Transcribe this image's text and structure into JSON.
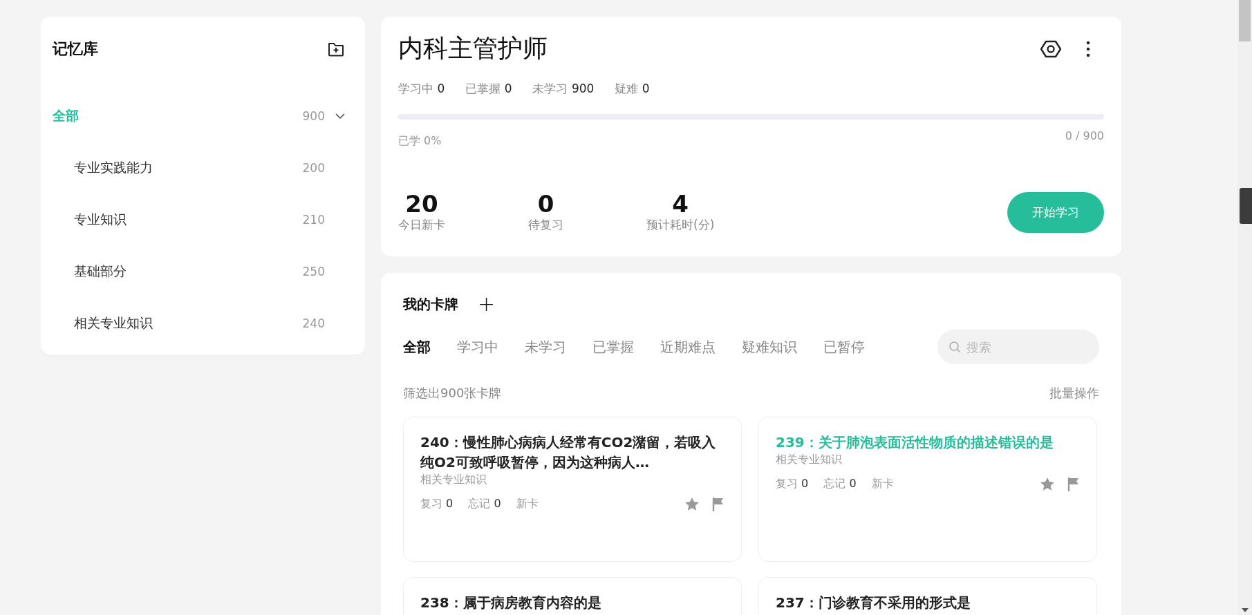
{
  "library": {
    "title": "记忆库",
    "items": [
      {
        "label": "全部",
        "count": "900",
        "selected": true,
        "expanded": true,
        "children": [
          {
            "label": "专业实践能力",
            "count": "200",
            "selected": false
          },
          {
            "label": "专业知识",
            "count": "210",
            "selected": false
          },
          {
            "label": "基础部分",
            "count": "250",
            "selected": false
          },
          {
            "label": "相关专业知识",
            "count": "240",
            "selected": false
          }
        ]
      }
    ]
  },
  "deck": {
    "title": "内科主管护师",
    "stats": [
      {
        "label": "学习中",
        "value": "0"
      },
      {
        "label": "已掌握",
        "value": "0"
      },
      {
        "label": "未学习",
        "value": "900"
      },
      {
        "label": "疑难",
        "value": "0"
      }
    ],
    "progress": {
      "level": 0,
      "label": "已学 0%",
      "count": "0 / 900"
    },
    "summary": [
      {
        "value": "20",
        "label": "今日新卡"
      },
      {
        "value": "0",
        "label": "待复习"
      },
      {
        "value": "4",
        "label": "预计耗时(分)"
      }
    ],
    "start_button": "开始学习"
  },
  "cards_panel": {
    "title": "我的卡牌",
    "add_button": "+",
    "tabs": [
      {
        "label": "全部",
        "selected": true
      },
      {
        "label": "学习中",
        "selected": false
      },
      {
        "label": "未学习",
        "selected": false
      },
      {
        "label": "已掌握",
        "selected": false
      },
      {
        "label": "近期难点",
        "selected": false
      },
      {
        "label": "疑难知识",
        "selected": false
      },
      {
        "label": "已暂停",
        "selected": false
      }
    ],
    "search": {
      "placeholder": "搜索"
    },
    "filter_text": "筛选出900张卡牌",
    "batch_button": "批量操作",
    "cards": [
      {
        "title": "240：慢性肺心病病人经常有CO2潴留，若吸入纯O2可致呼吸暂停，因为这种病人…",
        "category": "相关专业知识",
        "review": "复习",
        "review_count": "0",
        "forget": "忘记",
        "forget_count": "0",
        "status": "新卡",
        "selected": false
      },
      {
        "title": "239：关于肺泡表面活性物质的描述错误的是",
        "category": "相关专业知识",
        "review": "复习",
        "review_count": "0",
        "forget": "忘记",
        "forget_count": "0",
        "status": "新卡",
        "selected": true
      },
      {
        "title": "238：属于病房教育内容的是",
        "selected": false
      },
      {
        "title": "237：门诊教育不采用的形式是",
        "selected": false
      }
    ]
  }
}
